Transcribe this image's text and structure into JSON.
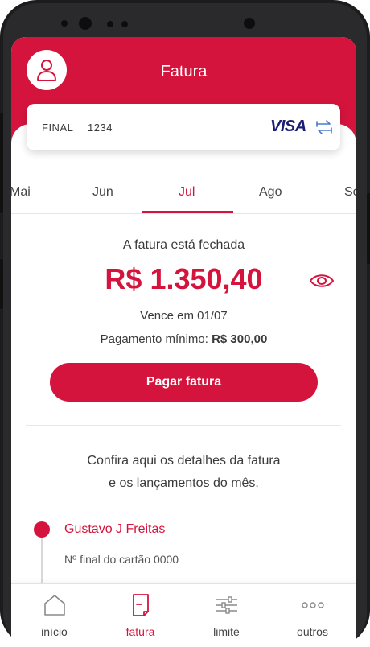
{
  "header": {
    "title": "Fatura"
  },
  "card": {
    "final_label": "FINAL",
    "final_number": "1234",
    "brand": "VISA"
  },
  "months": {
    "items": [
      "Mai",
      "Jun",
      "Jul",
      "Ago",
      "Se"
    ],
    "selected": "Jul"
  },
  "invoice": {
    "status": "A fatura está fechada",
    "amount": "R$ 1.350,40",
    "due": "Vence em 01/07",
    "minimum_label": "Pagamento mínimo:",
    "minimum_value": "R$ 300,00",
    "pay_button": "Pagar fatura"
  },
  "details": {
    "line1": "Confira aqui os detalhes da fatura",
    "line2": "e os lançamentos do mês."
  },
  "holder": {
    "name": "Gustavo J Freitas",
    "card_final": "Nº final do cartão 0000"
  },
  "bottom_nav": {
    "items": [
      {
        "label": "início",
        "icon": "home-icon"
      },
      {
        "label": "fatura",
        "icon": "invoice-icon"
      },
      {
        "label": "limite",
        "icon": "sliders-icon"
      },
      {
        "label": "outros",
        "icon": "more-icon"
      }
    ],
    "active": "fatura"
  },
  "colors": {
    "brand_red": "#d5143d",
    "visa_blue": "#1a1f71",
    "text": "#3a3a3a",
    "background": "#ffffff"
  }
}
